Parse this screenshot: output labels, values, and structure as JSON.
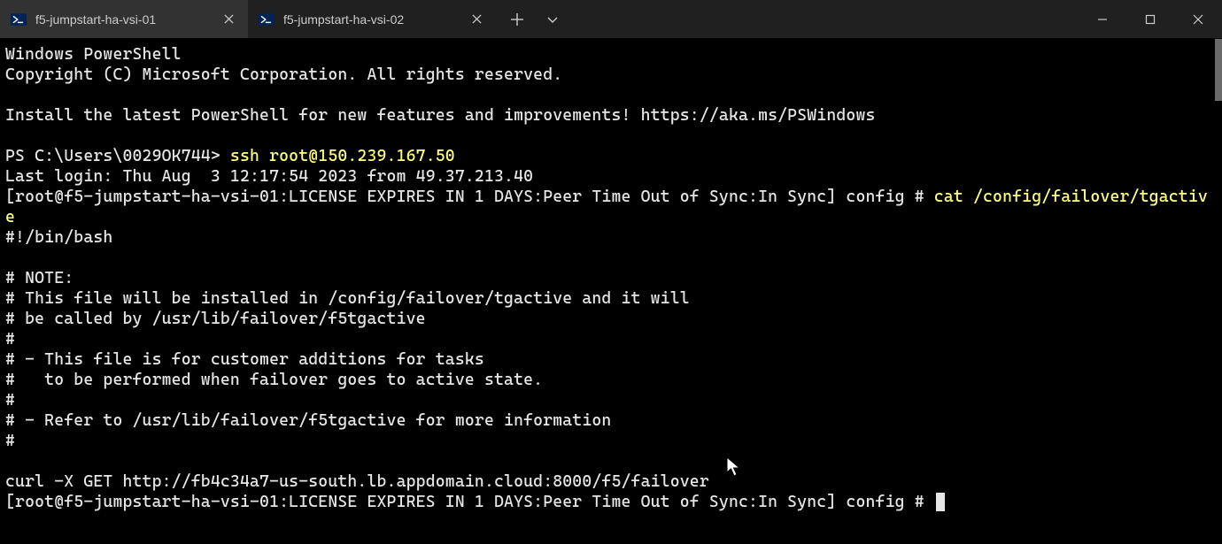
{
  "tabs": [
    {
      "label": "f5-jumpstart-ha-vsi-01",
      "active": true
    },
    {
      "label": "f5-jumpstart-ha-vsi-02",
      "active": false
    }
  ],
  "term": {
    "l1": "Windows PowerShell",
    "l2": "Copyright (C) Microsoft Corporation. All rights reserved.",
    "l3": "",
    "l4": "Install the latest PowerShell for new features and improvements! https://aka.ms/PSWindows",
    "l5": "",
    "prompt1": "PS C:\\Users\\0029OK744> ",
    "cmd1": "ssh root@150.239.167.50",
    "l7": "Last login: Thu Aug  3 12:17:54 2023 from 49.37.213.40",
    "l8a": "[root@f5-jumpstart-ha-vsi-01:LICENSE EXPIRES IN 1 DAYS:Peer Time Out of Sync:In Sync] config # ",
    "cmd2": "cat /config/failover/tgactive",
    "l9": "#!/bin/bash",
    "l10": "",
    "l11": "# NOTE:",
    "l12": "# This file will be installed in /config/failover/tgactive and it will",
    "l13": "# be called by /usr/lib/failover/f5tgactive",
    "l14": "#",
    "l15": "# - This file is for customer additions for tasks",
    "l16": "#   to be performed when failover goes to active state.",
    "l17": "#",
    "l18": "# - Refer to /usr/lib/failover/f5tgactive for more information",
    "l19": "#",
    "l20": "",
    "l21": "curl -X GET http://fb4c34a7-us-south.lb.appdomain.cloud:8000/f5/failover",
    "l22": "[root@f5-jumpstart-ha-vsi-01:LICENSE EXPIRES IN 1 DAYS:Peer Time Out of Sync:In Sync] config # "
  }
}
